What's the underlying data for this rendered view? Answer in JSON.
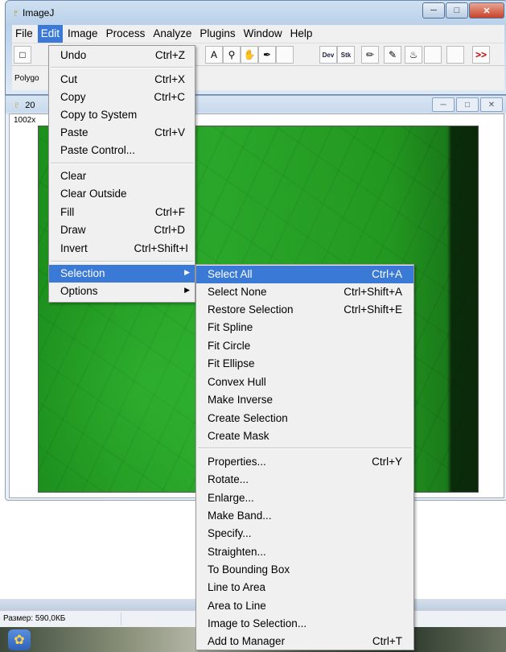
{
  "main_window": {
    "title": "ImageJ",
    "menubar": [
      "File",
      "Edit",
      "Image",
      "Process",
      "Analyze",
      "Plugins",
      "Window",
      "Help"
    ],
    "status": "Polygo"
  },
  "toolbar": {
    "text_tool": "A",
    "dev_label": "Dev",
    "stk_label": "Stk",
    "more_label": ">>"
  },
  "image_window": {
    "title": "20",
    "info": "1002x"
  },
  "edit_menu": {
    "items": [
      {
        "label": "Undo",
        "shortcut": "Ctrl+Z"
      },
      {
        "label": "Cut",
        "shortcut": "Ctrl+X"
      },
      {
        "label": "Copy",
        "shortcut": "Ctrl+C"
      },
      {
        "label": "Copy to System",
        "shortcut": ""
      },
      {
        "label": "Paste",
        "shortcut": "Ctrl+V"
      },
      {
        "label": "Paste Control...",
        "shortcut": ""
      },
      {
        "label": "Clear",
        "shortcut": ""
      },
      {
        "label": "Clear Outside",
        "shortcut": ""
      },
      {
        "label": "Fill",
        "shortcut": "Ctrl+F"
      },
      {
        "label": "Draw",
        "shortcut": "Ctrl+D"
      },
      {
        "label": "Invert",
        "shortcut": "Ctrl+Shift+I"
      },
      {
        "label": "Selection",
        "shortcut": ""
      },
      {
        "label": "Options",
        "shortcut": ""
      }
    ]
  },
  "selection_menu": {
    "items": [
      {
        "label": "Select All",
        "shortcut": "Ctrl+A"
      },
      {
        "label": "Select None",
        "shortcut": "Ctrl+Shift+A"
      },
      {
        "label": "Restore Selection",
        "shortcut": "Ctrl+Shift+E"
      },
      {
        "label": "Fit Spline",
        "shortcut": ""
      },
      {
        "label": "Fit Circle",
        "shortcut": ""
      },
      {
        "label": "Fit Ellipse",
        "shortcut": ""
      },
      {
        "label": "Convex Hull",
        "shortcut": ""
      },
      {
        "label": "Make Inverse",
        "shortcut": ""
      },
      {
        "label": "Create Selection",
        "shortcut": ""
      },
      {
        "label": "Create Mask",
        "shortcut": ""
      },
      {
        "label": "Properties...",
        "shortcut": "Ctrl+Y"
      },
      {
        "label": "Rotate...",
        "shortcut": ""
      },
      {
        "label": "Enlarge...",
        "shortcut": ""
      },
      {
        "label": "Make Band...",
        "shortcut": ""
      },
      {
        "label": "Specify...",
        "shortcut": ""
      },
      {
        "label": "Straighten...",
        "shortcut": ""
      },
      {
        "label": "To Bounding Box",
        "shortcut": ""
      },
      {
        "label": "Line to Area",
        "shortcut": ""
      },
      {
        "label": "Area to Line",
        "shortcut": ""
      },
      {
        "label": "Image to Selection...",
        "shortcut": ""
      },
      {
        "label": "Add to Manager",
        "shortcut": "Ctrl+T"
      }
    ]
  },
  "explorer_status": {
    "size": "Размер: 590,0КБ"
  },
  "colors": {
    "highlight": "#3a7ad6",
    "image_green": "#2aa82a"
  }
}
